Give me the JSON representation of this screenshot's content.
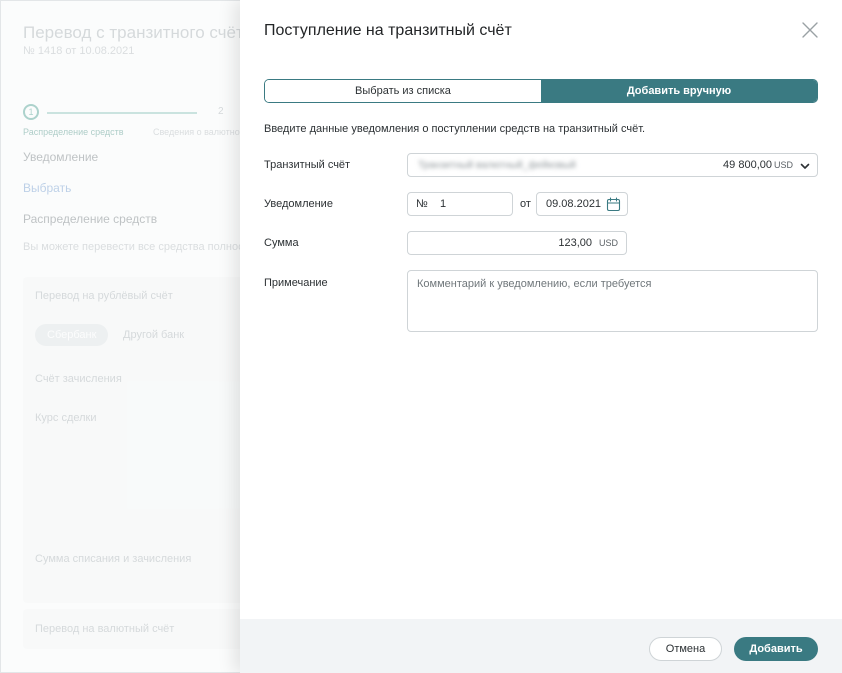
{
  "background": {
    "title": "Перевод с транзитного счёта",
    "subtitle": "№ 1418 от 10.08.2021",
    "step1_number": "1",
    "step2_number": "2",
    "step1_label": "Распределение средств",
    "step2_label": "Сведения о валютной операции",
    "notification_heading": "Уведомление",
    "choose_link": "Выбрать",
    "distribution_heading": "Распределение средств",
    "distribution_text": "Вы можете перевести все средства полностью",
    "ruble_transfer_title": "Перевод на рублёвый счёт",
    "bank_tab_active": "Сбербанк",
    "bank_tab_other": "Другой банк",
    "credit_account_label": "Счёт зачисления",
    "deal_rate_label": "Курс сделки",
    "debit_credit_amount_label": "Сумма списания и зачисления",
    "currency_transfer_title": "Перевод на валютный счёт"
  },
  "drawer": {
    "title": "Поступление на транзитный счёт",
    "tabs": [
      {
        "label": "Выбрать из списка",
        "active": false
      },
      {
        "label": "Добавить вручную",
        "active": true
      }
    ],
    "intro": "Введите данные уведомления о поступлении средств на транзитный счёт.",
    "transit_account": {
      "label": "Транзитный счёт",
      "account_name_blurred": "Транзитный валютный_фейковый",
      "amount": "49 800,00",
      "currency": "USD"
    },
    "notification": {
      "label": "Уведомление",
      "number_prefix": "№",
      "number_value": "1",
      "date_prefix": "от",
      "date_value": "09.08.2021"
    },
    "sum": {
      "label": "Сумма",
      "value": "123,00",
      "currency": "USD"
    },
    "note": {
      "label": "Примечание",
      "placeholder": "Комментарий к уведомлению, если требуется"
    },
    "buttons": {
      "cancel": "Отмена",
      "add": "Добавить"
    }
  },
  "colors": {
    "accent": "#3a7a82",
    "footer_bg": "#f2f4f6",
    "border": "#cfd4d7"
  },
  "icons": {
    "close": "close-icon",
    "chevron": "chevron-down-icon",
    "calendar": "calendar-icon"
  }
}
